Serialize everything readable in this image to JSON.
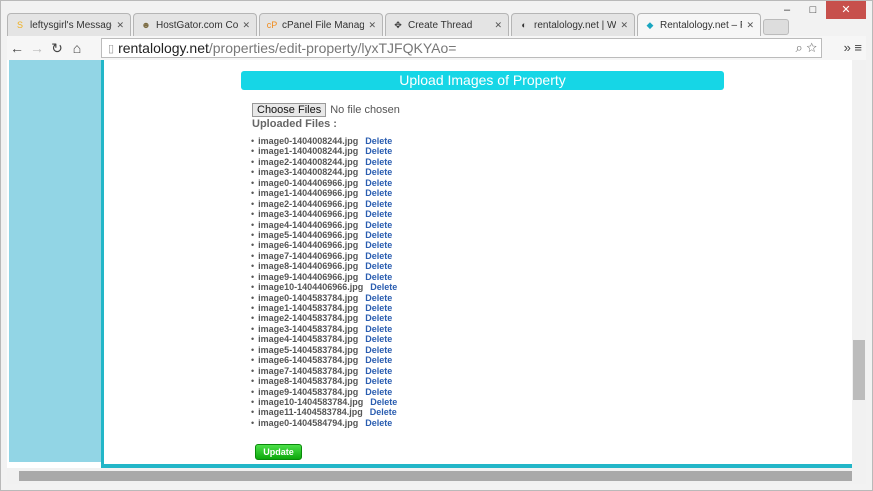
{
  "browser": {
    "tabs": [
      {
        "label": "leftysgirl's Messages",
        "icon": "S",
        "color": "#f0b020"
      },
      {
        "label": "HostGator.com Cont",
        "icon": "☻",
        "color": "#7a6a40"
      },
      {
        "label": "cPanel File Manager",
        "icon": "cP",
        "color": "#f08a1a"
      },
      {
        "label": "Create Thread",
        "icon": "✥",
        "color": "#333"
      },
      {
        "label": "rentalology.net | Web",
        "icon": "◐",
        "color": "#333"
      },
      {
        "label": "Rentalology.net – Fre",
        "icon": "◆",
        "color": "#1aa6c0",
        "active": true
      }
    ],
    "url_host": "rentalology.net",
    "url_path": "/properties/edit-property/lyxTJFQKYAo="
  },
  "page": {
    "header": "Upload Images of Property",
    "choose_files": "Choose Files",
    "no_file": "No file chosen",
    "uploaded_label": "Uploaded Files :",
    "delete_label": "Delete",
    "files": [
      "image0-1404008244.jpg",
      "image1-1404008244.jpg",
      "image2-1404008244.jpg",
      "image3-1404008244.jpg",
      "image0-1404406966.jpg",
      "image1-1404406966.jpg",
      "image2-1404406966.jpg",
      "image3-1404406966.jpg",
      "image4-1404406966.jpg",
      "image5-1404406966.jpg",
      "image6-1404406966.jpg",
      "image7-1404406966.jpg",
      "image8-1404406966.jpg",
      "image9-1404406966.jpg",
      "image10-1404406966.jpg",
      "image0-1404583784.jpg",
      "image1-1404583784.jpg",
      "image2-1404583784.jpg",
      "image3-1404583784.jpg",
      "image4-1404583784.jpg",
      "image5-1404583784.jpg",
      "image6-1404583784.jpg",
      "image7-1404583784.jpg",
      "image8-1404583784.jpg",
      "image9-1404583784.jpg",
      "image10-1404583784.jpg",
      "image11-1404583784.jpg",
      "image0-1404584794.jpg"
    ],
    "update": "Update"
  }
}
